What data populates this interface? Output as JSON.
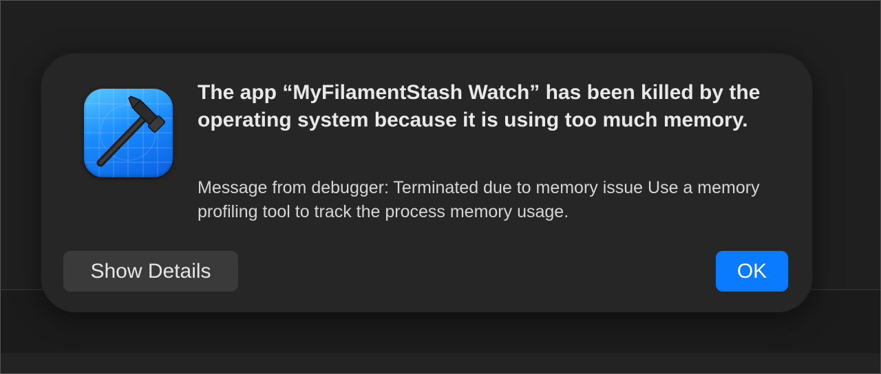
{
  "alert": {
    "title": "The app “MyFilamentStash Watch” has been killed by the operating system because it is using too much memory.",
    "message": "Message from debugger: Terminated due to memory issue Use a memory profiling tool to track the process memory usage.",
    "app_icon": "xcode-hammer-icon"
  },
  "buttons": {
    "show_details_label": "Show Details",
    "ok_label": "OK"
  },
  "colors": {
    "dialog_background": "#262626",
    "primary_button": "#0a7bff",
    "secondary_button": "#3a3a3a",
    "icon_blue": "#1a8cff"
  }
}
